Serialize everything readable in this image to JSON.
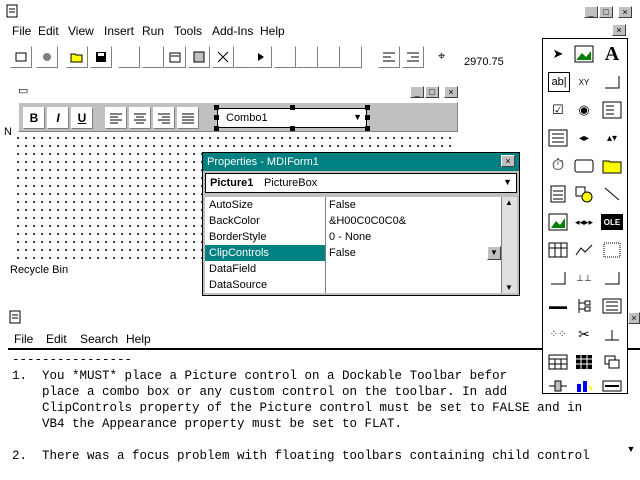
{
  "menubar": {
    "items": [
      "File",
      "Edit",
      "View",
      "Insert",
      "Run",
      "Tools",
      "Add-Ins",
      "Help"
    ]
  },
  "toolbar": {
    "coords": "2970.75"
  },
  "format_toolbar": {
    "bold": "B",
    "italic": "I",
    "underline": "U",
    "combo_value": "Combo1"
  },
  "properties": {
    "title": "Properties - MDIForm1",
    "object_name": "Picture1",
    "object_type": "PictureBox",
    "rows": [
      {
        "name": "AutoSize",
        "value": "False"
      },
      {
        "name": "BackColor",
        "value": "&H00C0C0C0&"
      },
      {
        "name": "BorderStyle",
        "value": "0 - None"
      },
      {
        "name": "ClipControls",
        "value": "False"
      },
      {
        "name": "DataField",
        "value": ""
      },
      {
        "name": "DataSource",
        "value": ""
      }
    ]
  },
  "desktop": {
    "recycle_bin": "Recycle Bin",
    "n_label": "N"
  },
  "notepad": {
    "menu": [
      "File",
      "Edit",
      "Search",
      "Help"
    ],
    "lines": [
      "----------------",
      "1.  You *MUST* place a Picture control on a Dockable Toolbar befor",
      "    place a combo box or any custom control on the toolbar. In add",
      "    ClipControls property of the Picture control must be set to FALSE and in",
      "    VB4 the Appearance property must be set to FLAT.",
      "",
      "2.  There was a focus problem with floating toolbars containing child control"
    ]
  },
  "toolbox": {
    "labels": {
      "text": "ab|",
      "letter": "A",
      "xy": "XY",
      "ole": "OLE"
    }
  }
}
